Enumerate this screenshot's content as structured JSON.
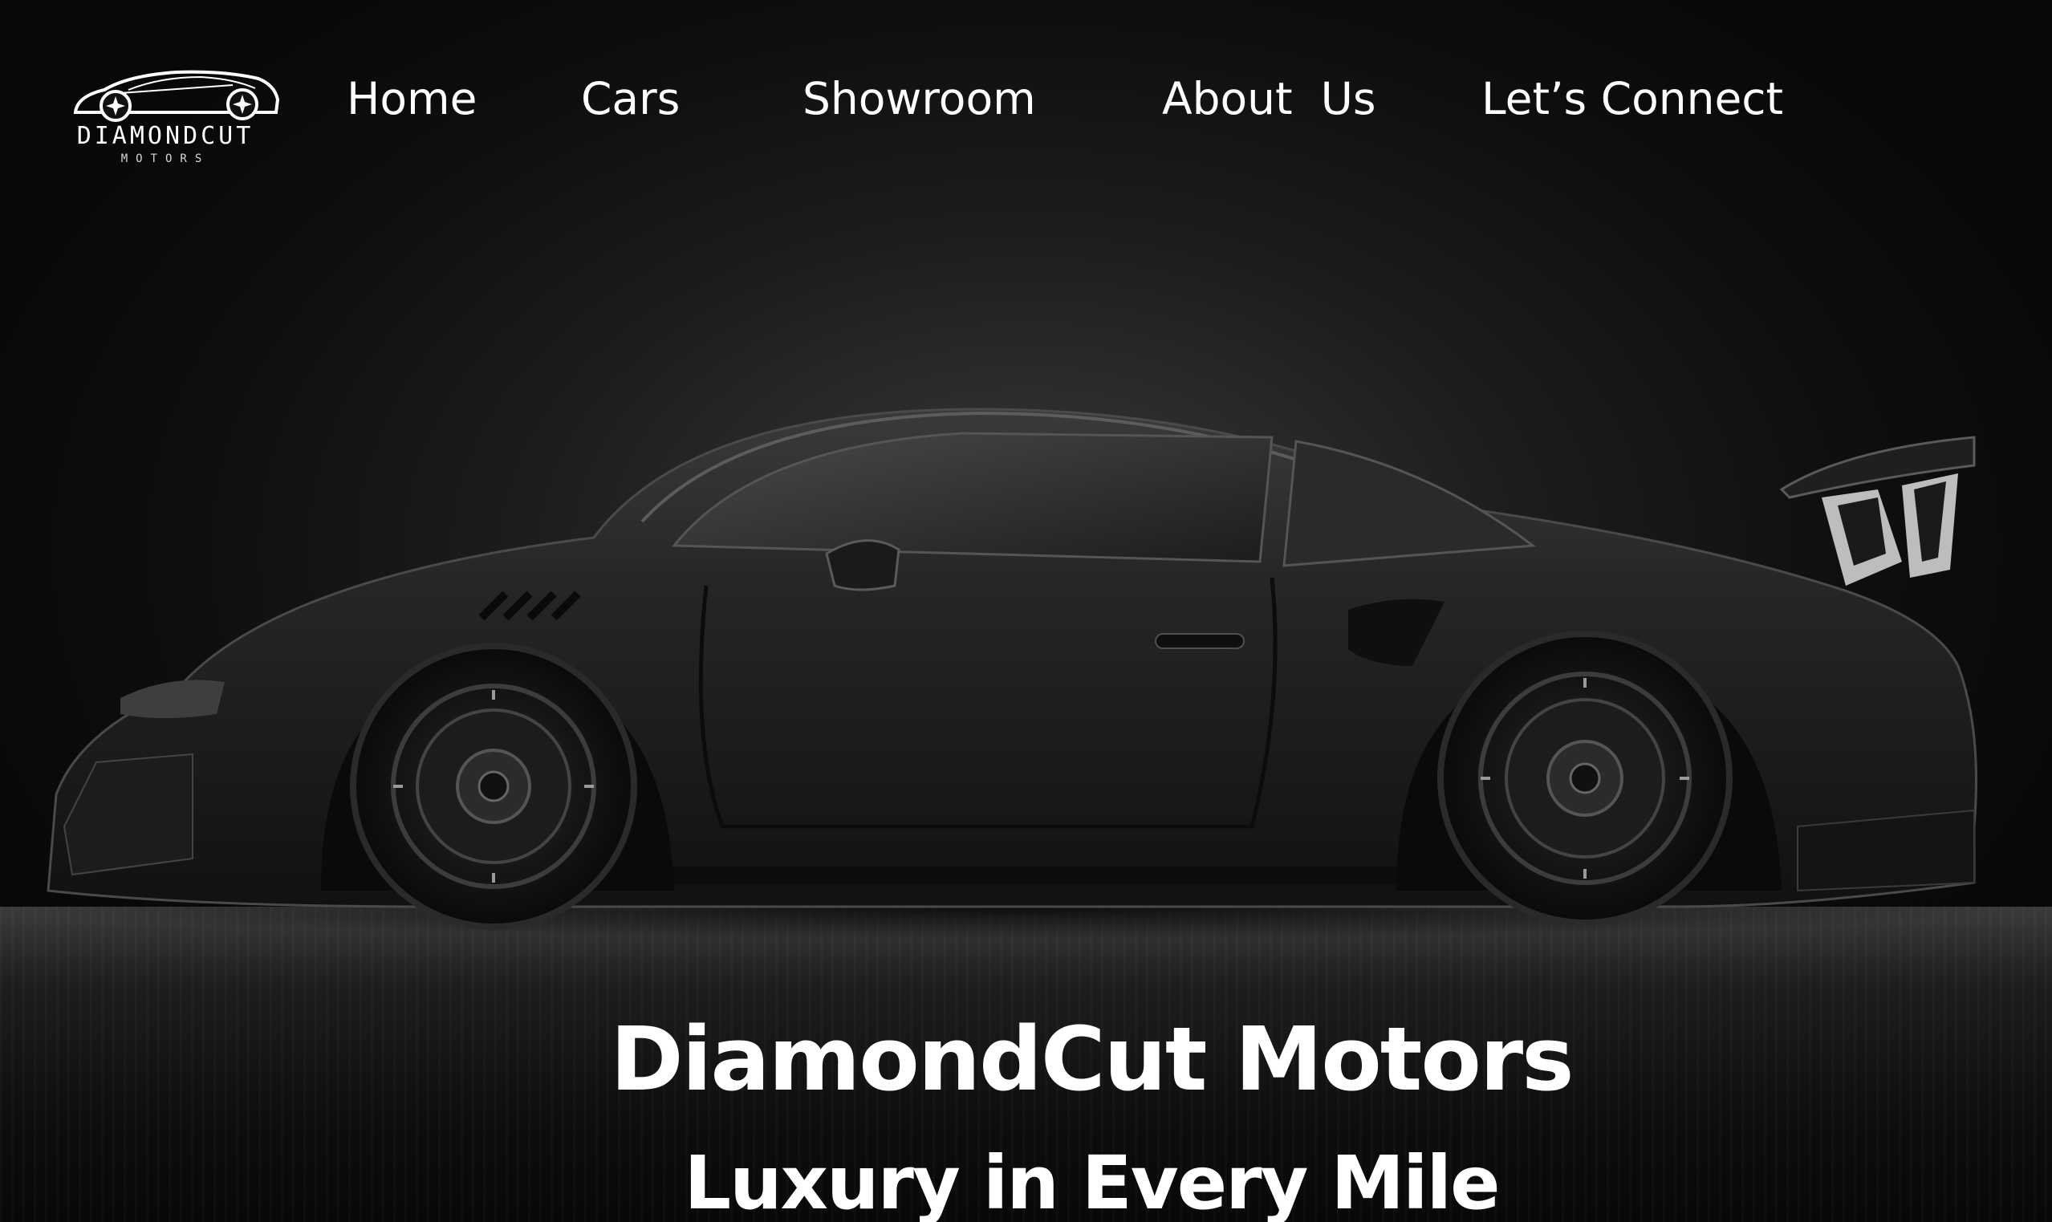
{
  "brand": {
    "name": "DIAMONDCUT",
    "sub": "MOTORS",
    "logo_icon": "sports-car-logo-icon"
  },
  "nav": {
    "items": [
      {
        "label": "Home"
      },
      {
        "label": "Cars"
      },
      {
        "label": "Showroom"
      },
      {
        "label": "About  Us"
      },
      {
        "label": "Let’s Connect"
      }
    ]
  },
  "hero": {
    "title": "DiamondCut Motors",
    "subtitle": "Luxury in Every Mile",
    "image": "black-sports-car-side-view"
  },
  "colors": {
    "background": "#0c0c0c",
    "text": "#ffffff"
  }
}
